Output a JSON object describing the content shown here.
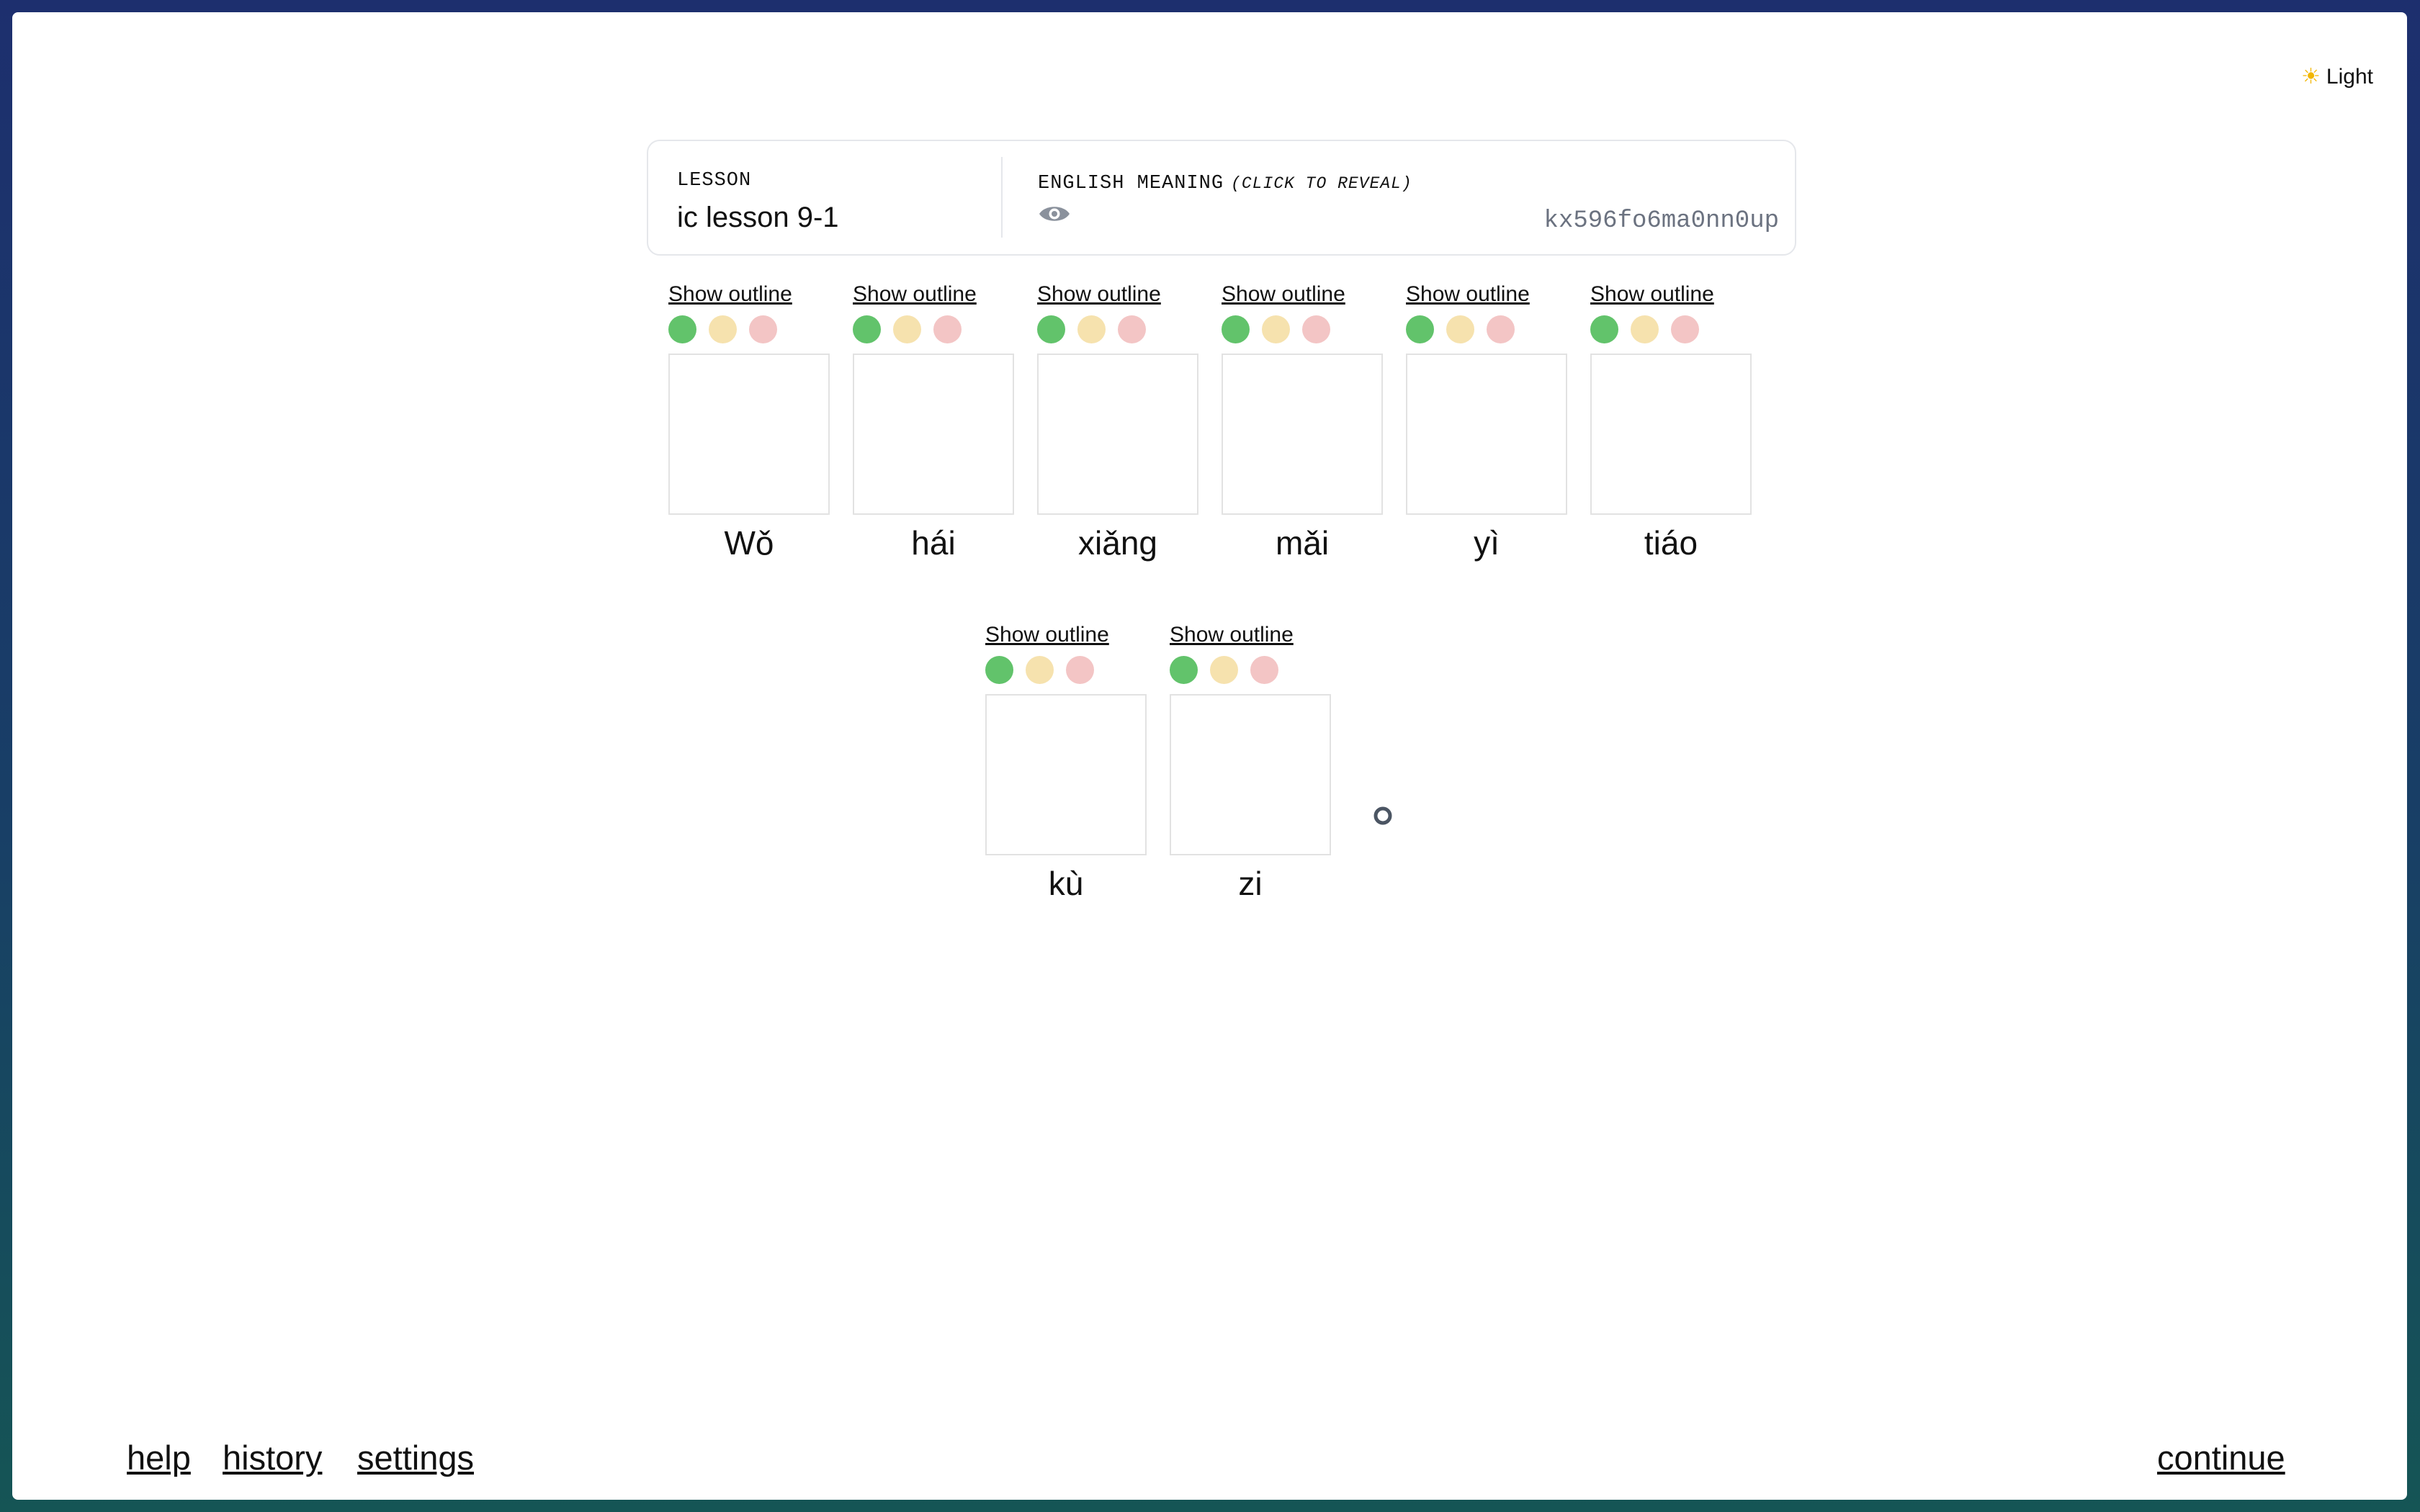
{
  "theme_toggle": {
    "icon": "sun-icon",
    "label": "Light"
  },
  "header": {
    "lesson_label": "LESSON",
    "lesson_name": "ic lesson 9-1",
    "meaning_label": "ENGLISH MEANING",
    "meaning_hint": "(CLICK TO REVEAL)",
    "reveal_icon": "eye-icon",
    "session_id": "kx596fo6ma0nn0up"
  },
  "characters": [
    {
      "outline_label": "Show outline",
      "pinyin": "Wǒ"
    },
    {
      "outline_label": "Show outline",
      "pinyin": "hái"
    },
    {
      "outline_label": "Show outline",
      "pinyin": "xiǎng"
    },
    {
      "outline_label": "Show outline",
      "pinyin": "mǎi"
    },
    {
      "outline_label": "Show outline",
      "pinyin": "yì"
    },
    {
      "outline_label": "Show outline",
      "pinyin": "tiáo"
    },
    {
      "outline_label": "Show outline",
      "pinyin": "kù"
    },
    {
      "outline_label": "Show outline",
      "pinyin": "zi"
    }
  ],
  "rating_colors": {
    "good": "#62c36b",
    "ok": "#f6e2ae",
    "bad": "#f3c5c5"
  },
  "punctuation_icon": "circle-period-icon",
  "footer": {
    "help": "help",
    "history": "history",
    "settings": "settings",
    "continue": "continue"
  }
}
